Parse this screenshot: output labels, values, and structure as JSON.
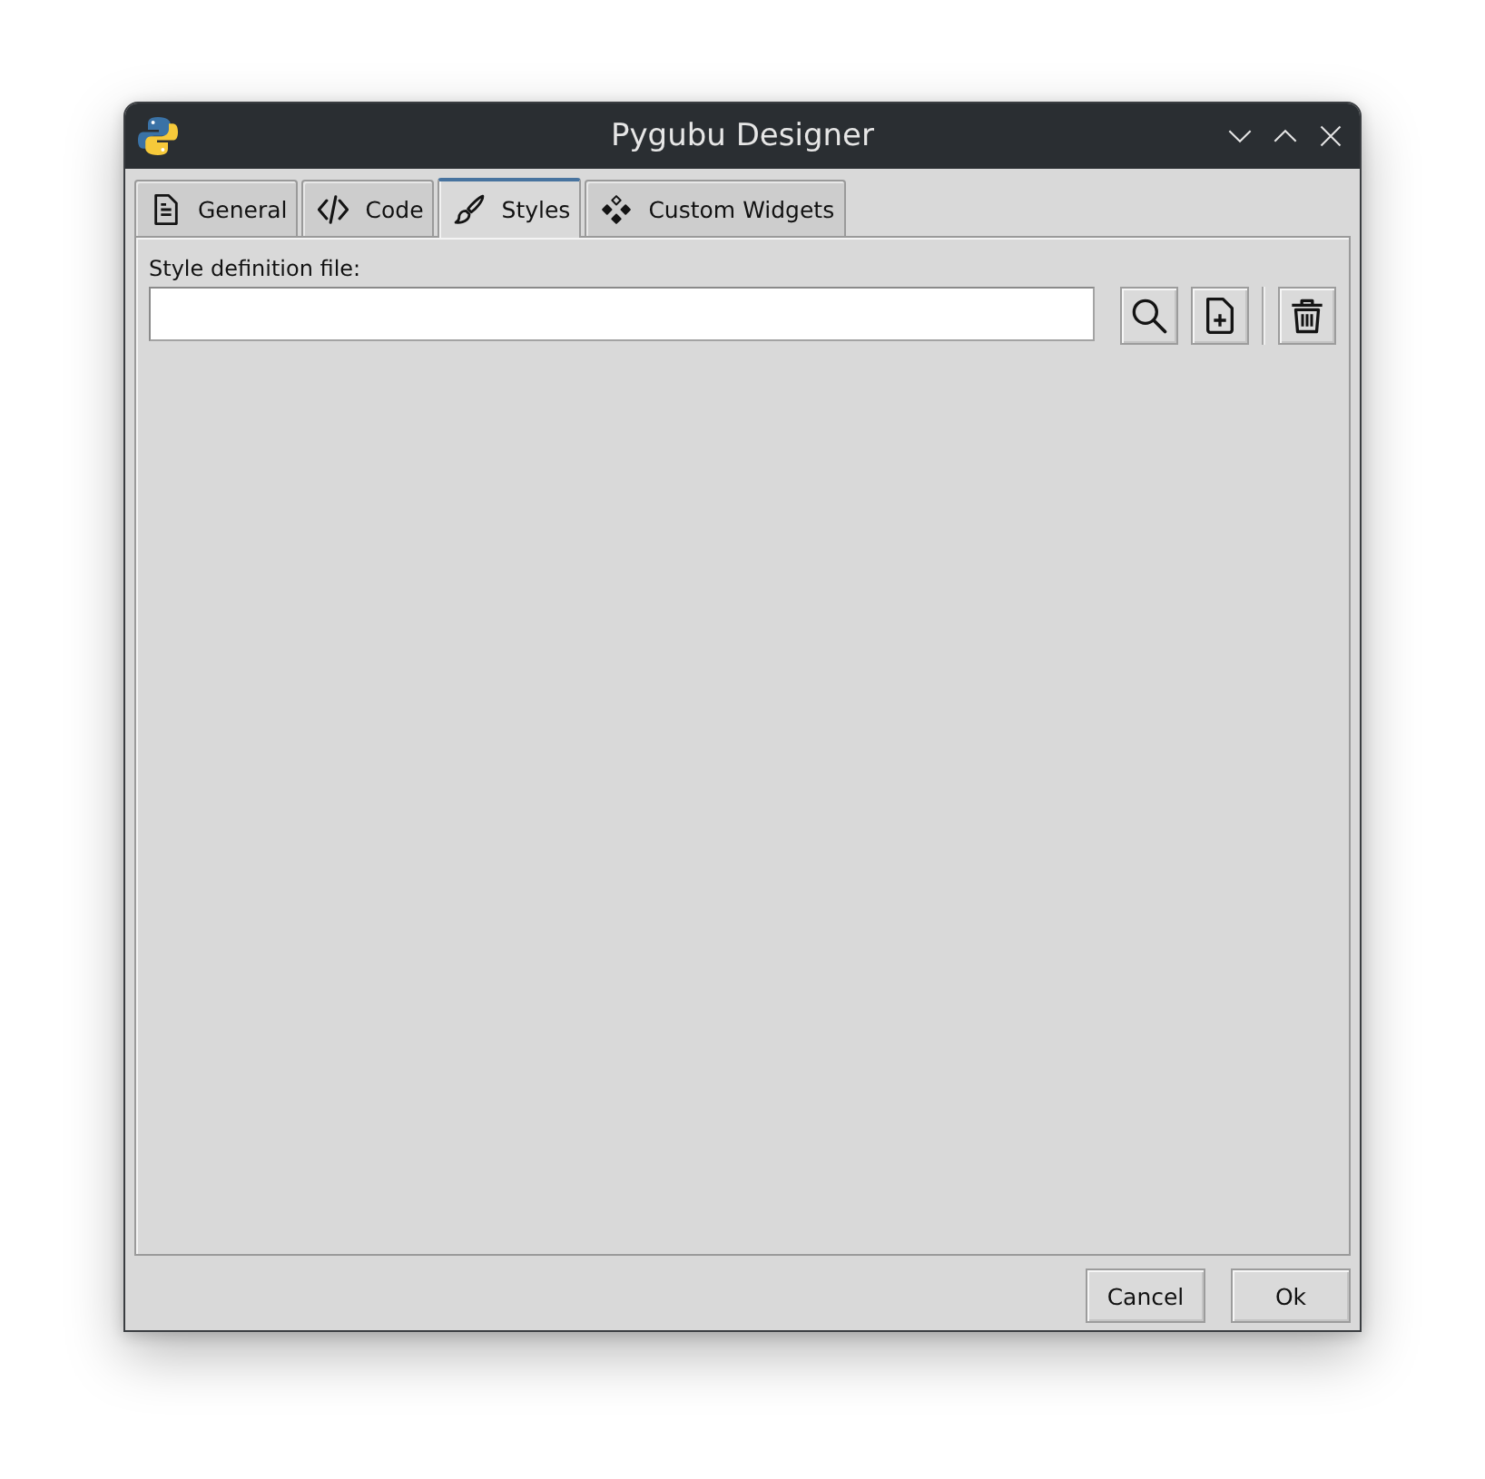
{
  "window": {
    "title": "Pygubu Designer"
  },
  "tabs": [
    {
      "label": "General",
      "selected": false
    },
    {
      "label": "Code",
      "selected": false
    },
    {
      "label": "Styles",
      "selected": true
    },
    {
      "label": "Custom Widgets",
      "selected": false
    }
  ],
  "style_file": {
    "label": "Style definition file:"
  },
  "buttons": [
    "Cancel",
    "Ok"
  ]
}
